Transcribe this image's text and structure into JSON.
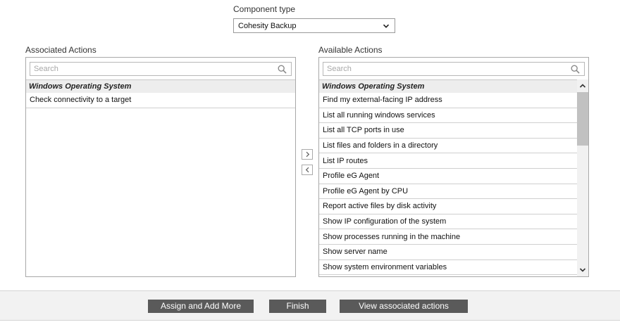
{
  "component": {
    "label": "Component type",
    "selected": "Cohesity Backup"
  },
  "associated": {
    "title": "Associated Actions",
    "search_placeholder": "Search",
    "group": "Windows Operating System",
    "items": [
      "Check connectivity to a target"
    ]
  },
  "available": {
    "title": "Available Actions",
    "search_placeholder": "Search",
    "group": "Windows Operating System",
    "items": [
      "Find my external-facing IP address",
      "List all running windows services",
      "List all TCP ports in use",
      "List files and folders in a directory",
      "List IP routes",
      "Profile eG Agent",
      "Profile eG Agent by CPU",
      "Report active files by disk activity",
      "Show IP configuration of the system",
      "Show processes running in the machine",
      "Show server name",
      "Show system environment variables"
    ]
  },
  "buttons": {
    "assign_more": "Assign and Add More",
    "finish": "Finish",
    "view_associated": "View associated actions"
  },
  "icons": {
    "dropdown": "chevron-down-icon",
    "search": "search-icon",
    "move_right": "chevron-right-icon",
    "move_left": "chevron-left-icon",
    "scroll_up": "chevron-up-icon",
    "scroll_down": "chevron-down-icon"
  }
}
